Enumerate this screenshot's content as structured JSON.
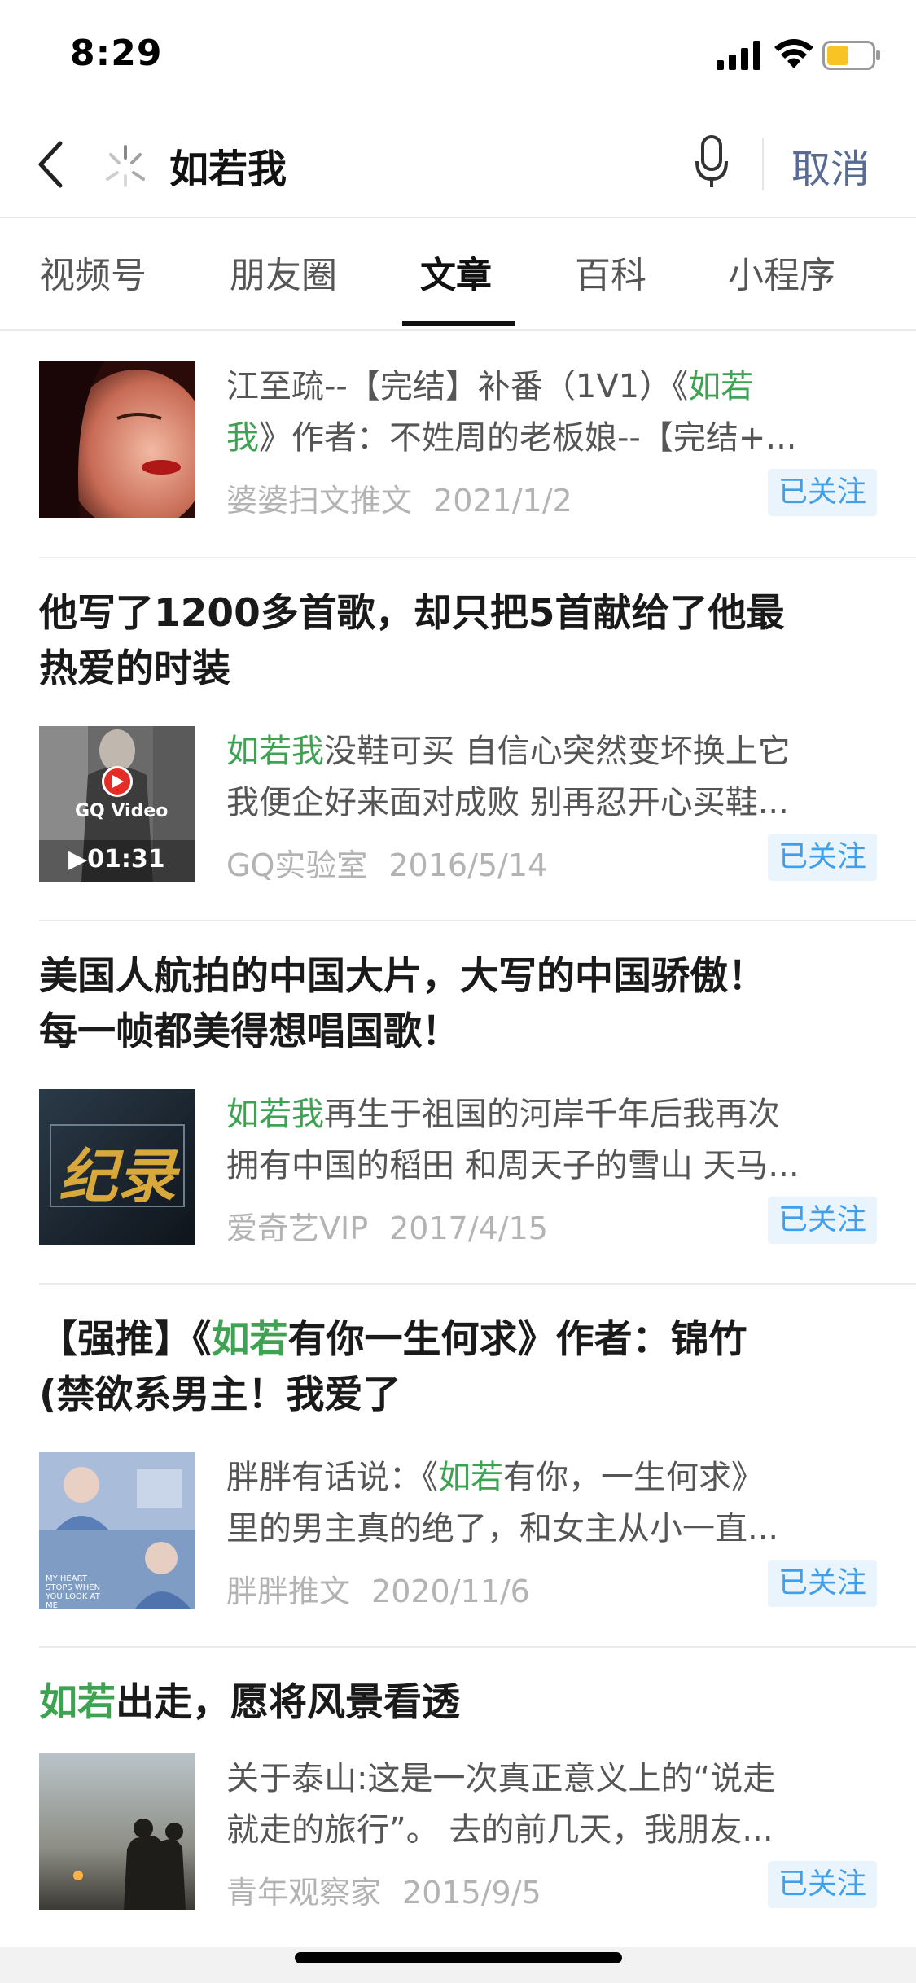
{
  "status_bar": {
    "time": "8:29"
  },
  "search": {
    "query": "如若我",
    "cancel_label": "取消"
  },
  "tabs": [
    {
      "label": "视频号"
    },
    {
      "label": "朋友圈"
    },
    {
      "label": "文章"
    },
    {
      "label": "百科"
    },
    {
      "label": "小程序"
    }
  ],
  "active_tab": "文章",
  "articles": [
    {
      "title": [],
      "snippet_line1": [
        "江至疏--【完结】补番（1V1）《",
        "如若",
        ""
      ],
      "snippet_line2": [
        "",
        "我",
        "》作者：不姓周的老板娘--【完结+..."
      ],
      "source": "婆婆扫文推文",
      "date": "2021/1/2",
      "follow_label": "已关注",
      "thumb_icon": "portrait-red-lips-image"
    },
    {
      "title": [
        "他写了1200多首歌，却只把5首献给了他最",
        "热爱的时装"
      ],
      "snippet_line1": [
        "",
        "如若我",
        "没鞋可买 自信心突然变坏换上它"
      ],
      "snippet_line2": [
        "",
        "",
        "我便企好来面对成败 别再忍开心买鞋..."
      ],
      "source": "GQ实验室",
      "date": "2016/5/14",
      "follow_label": "已关注",
      "thumb_overlay": "GQ Video",
      "thumb_duration": "01:31"
    },
    {
      "title": [
        "美国人航拍的中国大片，大写的中国骄傲！",
        "每一帧都美得想唱国歌！"
      ],
      "snippet_line1": [
        "",
        "如若我",
        "再生于祖国的河岸千年后我再次"
      ],
      "snippet_line2": [
        "",
        "",
        "拥有中国的稻田 和周天子的雪山 天马..."
      ],
      "source": "爱奇艺VIP",
      "date": "2017/4/15",
      "follow_label": "已关注",
      "thumb_text": "纪录"
    },
    {
      "title_parts": [
        "【强推】《",
        "如若",
        "有你一生何求》作者：锦竹"
      ],
      "title_line2": "(禁欲系男主！我爱了",
      "snippet_line1": [
        "胖胖有话说：《",
        "如若",
        "有你，一生何求》"
      ],
      "snippet_line2": [
        "",
        "",
        "里的男主真的绝了，和女主从小一直..."
      ],
      "source": "胖胖推文",
      "date": "2020/11/6",
      "follow_label": "已关注",
      "thumb_caption": "MY HEART STOPS WHEN YOU LOOK AT ME"
    },
    {
      "title_parts": [
        "",
        "如若",
        "出走，愿将风景看透"
      ],
      "snippet_line1": [
        "",
        "",
        "关于泰山:这是一次真正意义上的“说走"
      ],
      "snippet_line2": [
        "",
        "",
        "就走的旅行”。 去的前几天，我朋友..."
      ],
      "source": "青年观察家",
      "date": "2015/9/5",
      "follow_label": "已关注",
      "thumb_icon": "sunset-silhouette-image"
    }
  ],
  "colors": {
    "highlight": "#3ea253",
    "link_blue": "#576b95",
    "follow_bg": "#eaf4fd",
    "follow_text": "#3f9fea"
  }
}
